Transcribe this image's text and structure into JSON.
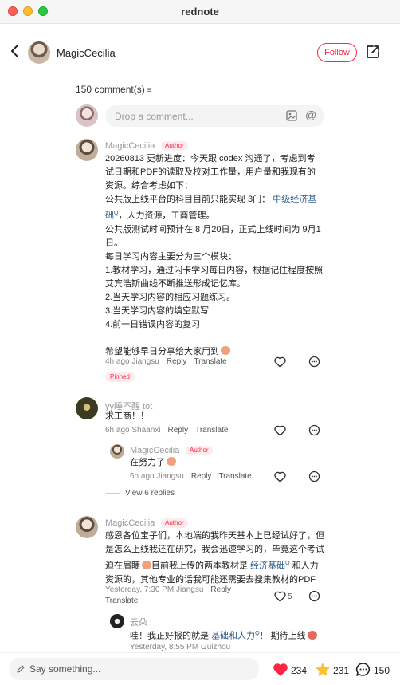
{
  "window": {
    "title": "rednote"
  },
  "header": {
    "author": "MagicCecilia",
    "follow_label": "Follow"
  },
  "comments_header": {
    "count_label": "150 comment(s)"
  },
  "composer": {
    "placeholder": "Drop a comment..."
  },
  "comments": [
    {
      "user": "MagicCecilia",
      "badge": "Author",
      "lines": [
        "20260813 更新进度：今天跟 codex 沟通了，考虑到考",
        "试日期和PDF的读取及校对工作量，用户量和我现有的",
        "资源。综合考虑如下：",
        "公共版上线平台的科目目前只能实现 3门：",
        "础",
        "，人力资源，工商管理。",
        "公共版测试时间预计在 8 月20日，正式上线时间为 9月1",
        "日。",
        "每日学习内容主要分为三个模块：",
        "1.教材学习，通过闪卡学习每日内容，根据记住程度按照",
        "艾宾浩斯曲线不断推送形成记忆库。",
        "2.当天学习内容的相应习题练习。",
        "3.当天学习内容的填空默写",
        "4.前一日错误内容的复习",
        "希望能够早日分享给大家用到"
      ],
      "link_text": "中级经济基",
      "time": "4h ago Jiangsu",
      "reply_label": "Reply",
      "translate_label": "Translate",
      "pinned_label": "Pinned"
    },
    {
      "user": "yy睡不醒 tot",
      "text": "求工商！！",
      "time": "6h ago Shaanxi",
      "reply_label": "Reply",
      "translate_label": "Translate",
      "reply": {
        "user": "MagicCecilia",
        "badge": "Author",
        "text": "在努力了",
        "time": "6h ago Jiangsu",
        "reply_label": "Reply",
        "translate_label": "Translate"
      },
      "view_more": "View 6 replies"
    },
    {
      "user": "MagicCecilia",
      "badge": "Author",
      "lines": [
        "感恩各位宝子们，本地端的我昨天基本上已经试好了，但",
        "是怎么上线我还在研究，我会迅速学习的，毕竟这个考试",
        "迫在眉睫",
        "目前我上传的两本教材是",
        "和人力",
        "资源的，其他专业的话我可能还需要去搜集教材的PDF"
      ],
      "link_text": "经济基础",
      "time": "Yesterday, 7:30 PM Jiangsu",
      "reply_label": "Reply",
      "translate_label": "Translate",
      "likes": "5",
      "reply": {
        "user": "云朵",
        "text_before": "哇！我正好报的就是",
        "link_text": "基础和人力",
        "text_after": "！ 期待上线",
        "time": "Yesterday, 8:55 PM Guizhou"
      }
    }
  ],
  "bottom_bar": {
    "placeholder": "Say something...",
    "likes": "234",
    "collects": "231",
    "comments": "150"
  },
  "colors": {
    "accent": "#ff2442",
    "link": "#2d5a8c"
  }
}
